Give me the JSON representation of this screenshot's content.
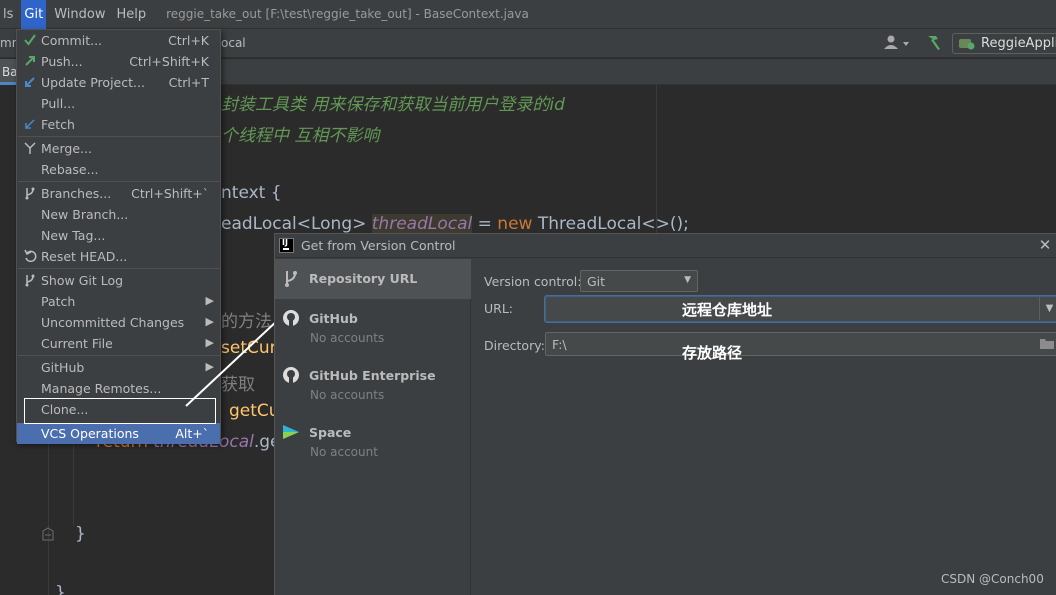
{
  "window": {
    "title": "reggie_take_out [F:\\test\\reggie_take_out] - BaseContext.java"
  },
  "menubar": {
    "items": [
      "ls",
      "Git",
      "Window",
      "Help"
    ]
  },
  "toolbar": {
    "left_fragment": "mn",
    "mid_fragment": "ocal",
    "run_config": "ReggieApplic"
  },
  "tabs": {
    "active_fragment": "Ba"
  },
  "editor": {
    "line1": "封装工具类  用来保存和获取当前用户登录的id",
    "line2": "个线程中  互相不影响",
    "line3": "ntext {",
    "line4_a": "eadLocal<Long> ",
    "line4_field": "threadLocal",
    "line4_b": " = ",
    "line4_kw": "new",
    "line4_c": " ThreadLocal<>();",
    "line5": "的方法",
    "line6": "setCur",
    "line7": "获取",
    "line8": "getCu",
    "line9_kw": "return",
    "line9_field": "threadLocal",
    "line9_b": ".ge",
    "closing_brace": "}",
    "bottom_brace": "}"
  },
  "git_menu": {
    "items": [
      {
        "label": "Commit...",
        "shortcut": "Ctrl+K",
        "icon": "check-icon"
      },
      {
        "label": "Push...",
        "shortcut": "Ctrl+Shift+K",
        "icon": "push-arrow-icon"
      },
      {
        "label": "Update Project...",
        "shortcut": "Ctrl+T",
        "icon": "update-arrow-icon"
      },
      {
        "label": "Pull...",
        "shortcut": "",
        "icon": ""
      },
      {
        "label": "Fetch",
        "shortcut": "",
        "icon": "fetch-icon"
      },
      {
        "label": "Merge...",
        "shortcut": "",
        "icon": "merge-icon"
      },
      {
        "label": "Rebase...",
        "shortcut": "",
        "icon": ""
      },
      {
        "label": "Branches...",
        "shortcut": "Ctrl+Shift+`",
        "icon": "branch-icon"
      },
      {
        "label": "New Branch...",
        "shortcut": "",
        "icon": ""
      },
      {
        "label": "New Tag...",
        "shortcut": "",
        "icon": ""
      },
      {
        "label": "Reset HEAD...",
        "shortcut": "",
        "icon": "reset-icon"
      },
      {
        "label": "Show Git Log",
        "shortcut": "",
        "icon": "branch-icon"
      },
      {
        "label": "Patch",
        "shortcut": "",
        "icon": "",
        "submenu": true
      },
      {
        "label": "Uncommitted Changes",
        "shortcut": "",
        "icon": "",
        "submenu": true
      },
      {
        "label": "Current File",
        "shortcut": "",
        "icon": "",
        "submenu": true
      },
      {
        "label": "GitHub",
        "shortcut": "",
        "icon": "",
        "submenu": true
      },
      {
        "label": "Manage Remotes...",
        "shortcut": "",
        "icon": ""
      },
      {
        "label": "Clone...",
        "shortcut": "",
        "icon": ""
      },
      {
        "label": "VCS Operations",
        "shortcut": "Alt+`",
        "icon": "",
        "selected": true
      }
    ]
  },
  "dialog": {
    "title": "Get from Version Control",
    "sidebar": [
      {
        "name": "Repository URL",
        "sub": "",
        "icon": "branch-icon"
      },
      {
        "name": "GitHub",
        "sub": "No accounts",
        "icon": "github-icon"
      },
      {
        "name": "GitHub Enterprise",
        "sub": "No accounts",
        "icon": "github-icon"
      },
      {
        "name": "Space",
        "sub": "No account",
        "icon": "space-icon"
      }
    ],
    "version_control_label": "Version control:",
    "version_control_value": "Git",
    "url_label": "URL:",
    "url_value": "",
    "directory_label": "Directory:",
    "directory_value": "F:\\"
  },
  "annotations": {
    "url_note": "远程仓库地址",
    "dir_note": "存放路径"
  },
  "watermark": "CSDN @Conch00",
  "colors": {
    "menu_selected": "#4b6eaf",
    "menubar_active": "#2f65ca",
    "comment_green": "#629755",
    "keyword_orange": "#cc7832",
    "method_yellow": "#ffc66d",
    "field_purple": "#9876aa"
  }
}
